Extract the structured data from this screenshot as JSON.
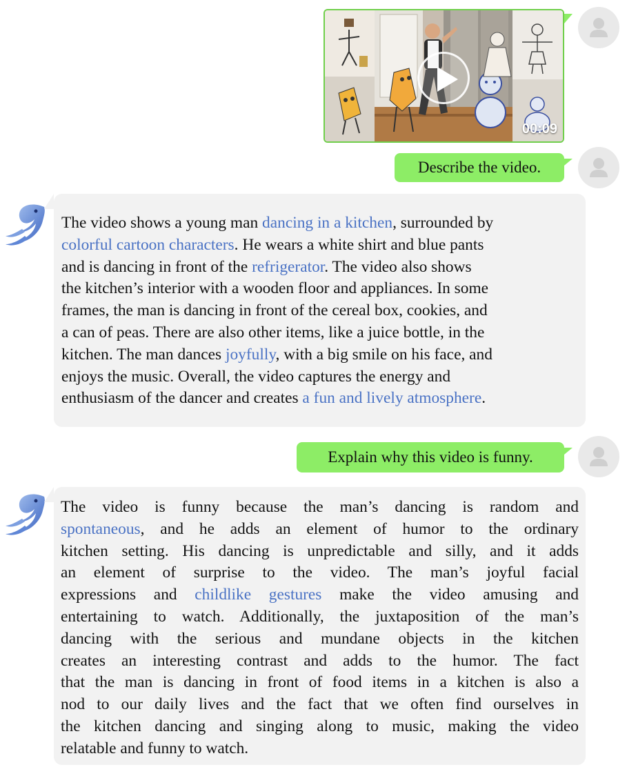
{
  "video": {
    "duration": "00:09",
    "play_icon": "play-icon"
  },
  "messages": [
    {
      "role": "user",
      "text": "Describe the video."
    },
    {
      "role": "assistant",
      "lines": [
        [
          {
            "t": "The video shows a young man "
          },
          {
            "t": "dancing in a kitchen",
            "hl": true
          },
          {
            "t": ", surrounded by"
          }
        ],
        [
          {
            "t": "colorful cartoon characters",
            "hl": true
          },
          {
            "t": ". He wears a white shirt and blue pants"
          }
        ],
        [
          {
            "t": "and is dancing in front of the "
          },
          {
            "t": "refrigerator",
            "hl": true
          },
          {
            "t": ". The video also shows"
          }
        ],
        [
          {
            "t": "the kitchen’s interior with a wooden floor and appliances. In some"
          }
        ],
        [
          {
            "t": "frames, the man is dancing in front of the cereal box, cookies, and"
          }
        ],
        [
          {
            "t": "a can of peas. There are also other items, like a juice bottle, in the"
          }
        ],
        [
          {
            "t": "kitchen. The man dances "
          },
          {
            "t": "joyfully",
            "hl": true
          },
          {
            "t": ", with a big smile on his face, and"
          }
        ],
        [
          {
            "t": "enjoys the music. Overall, the video captures the energy and"
          }
        ],
        [
          {
            "t": "enthusiasm of the dancer and creates "
          },
          {
            "t": "a fun and lively atmosphere",
            "hl": true
          },
          {
            "t": "."
          }
        ]
      ]
    },
    {
      "role": "user",
      "text": "Explain why this video is funny."
    },
    {
      "role": "assistant",
      "lines": [
        [
          {
            "t": "The video is funny because the man’s dancing is random and"
          }
        ],
        [
          {
            "t": "spontaneous",
            "hl": true
          },
          {
            "t": ", and he adds an element of humor to the ordinary"
          }
        ],
        [
          {
            "t": "kitchen setting. His dancing is unpredictable and silly, and it adds"
          }
        ],
        [
          {
            "t": "an element of surprise to the video. The man’s joyful facial"
          }
        ],
        [
          {
            "t": "expressions and "
          },
          {
            "t": "childlike gestures",
            "hl": true
          },
          {
            "t": " make the video amusing and"
          }
        ],
        [
          {
            "t": "entertaining to watch. Additionally, the juxtaposition of the man’s"
          }
        ],
        [
          {
            "t": "dancing with the serious and mundane objects in the kitchen"
          }
        ],
        [
          {
            "t": "creates an interesting contrast and adds to the humor. The fact"
          }
        ],
        [
          {
            "t": "that the man is dancing in front of food items in a kitchen is also a"
          }
        ],
        [
          {
            "t": "nod to our daily lives and the fact that we often find ourselves in"
          }
        ],
        [
          {
            "t": "the kitchen dancing and singing along to music, making the video"
          }
        ],
        [
          {
            "t": "relatable and funny to watch."
          }
        ]
      ]
    }
  ],
  "colors": {
    "user_bubble": "#8ded66",
    "bot_bubble": "#f2f2f2",
    "highlight": "#4a72c4",
    "avatar_bg": "#e9e9e9"
  }
}
